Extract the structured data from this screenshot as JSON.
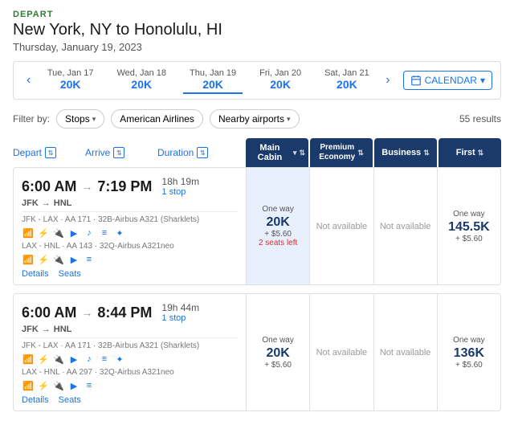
{
  "header": {
    "depart_label": "DEPART",
    "route": "New York, NY to Honolulu, HI",
    "date": "Thursday, January 19, 2023"
  },
  "date_nav": {
    "prev_arrow": "‹",
    "next_arrow": "›",
    "calendar_label": "CALENDAR",
    "dates": [
      {
        "label": "Tue, Jan 17",
        "points": "20K",
        "active": false
      },
      {
        "label": "Wed, Jan 18",
        "points": "20K",
        "active": false
      },
      {
        "label": "Thu, Jan 19",
        "points": "20K",
        "active": true
      },
      {
        "label": "Fri, Jan 20",
        "points": "20K",
        "active": false
      },
      {
        "label": "Sat, Jan 21",
        "points": "20K",
        "active": false
      }
    ]
  },
  "filters": {
    "stops_label": "Stops",
    "airline_label": "American Airlines",
    "nearby_label": "Nearby airports",
    "results": "55 results"
  },
  "col_headers": {
    "depart": "Depart",
    "arrive": "Arrive",
    "duration": "Duration",
    "main_cabin": "Main Cabin",
    "premium_economy": "Premium Economy",
    "business": "Business",
    "first": "First"
  },
  "flights": [
    {
      "depart_time": "6:00 AM",
      "arrive_time": "7:19 PM",
      "arrive_airport": "HNL",
      "depart_airport": "JFK",
      "duration": "18h 19m",
      "stops": "1 stop",
      "detail1": "JFK - LAX · AA 171 · 32B-Airbus A321 (Sharklets)",
      "amenities1": [
        "wifi",
        "power",
        "usb",
        "video",
        "music",
        "seat",
        "food"
      ],
      "detail2": "LAX - HNL · AA 143 · 32Q-Airbus A321neo",
      "amenities2": [
        "wifi",
        "power",
        "usb",
        "video",
        "seat"
      ],
      "main_cabin": {
        "label": "One way",
        "amount": "20K",
        "fee": "+ $5.60",
        "seats": "2 seats left"
      },
      "premium_economy": {
        "unavailable": true,
        "label": "Not available"
      },
      "business": {
        "unavailable": true,
        "label": "Not available"
      },
      "first": {
        "label": "One way",
        "amount": "145.5K",
        "fee": "+ $5.60"
      }
    },
    {
      "depart_time": "6:00 AM",
      "arrive_time": "8:44 PM",
      "arrive_airport": "HNL",
      "depart_airport": "JFK",
      "duration": "19h 44m",
      "stops": "1 stop",
      "detail1": "JFK - LAX · AA 171 · 32B-Airbus A321 (Sharklets)",
      "amenities1": [
        "wifi",
        "power",
        "usb",
        "video",
        "music",
        "seat",
        "food"
      ],
      "detail2": "LAX - HNL · AA 297 · 32Q-Airbus A321neo",
      "amenities2": [
        "wifi",
        "power",
        "usb",
        "video",
        "seat"
      ],
      "main_cabin": {
        "label": "One way",
        "amount": "20K",
        "fee": "+ $5.60"
      },
      "premium_economy": {
        "unavailable": true,
        "label": "Not available"
      },
      "business": {
        "unavailable": true,
        "label": "Not available"
      },
      "first": {
        "label": "One way",
        "amount": "136K",
        "fee": "+ $5.60"
      }
    }
  ],
  "amenity_icons": {
    "wifi": "📶",
    "power": "⚡",
    "usb": "🔌",
    "video": "📺",
    "music": "🎵",
    "seat": "💺",
    "food": "🍽"
  },
  "links": {
    "details": "Details",
    "seats": "Seats"
  }
}
